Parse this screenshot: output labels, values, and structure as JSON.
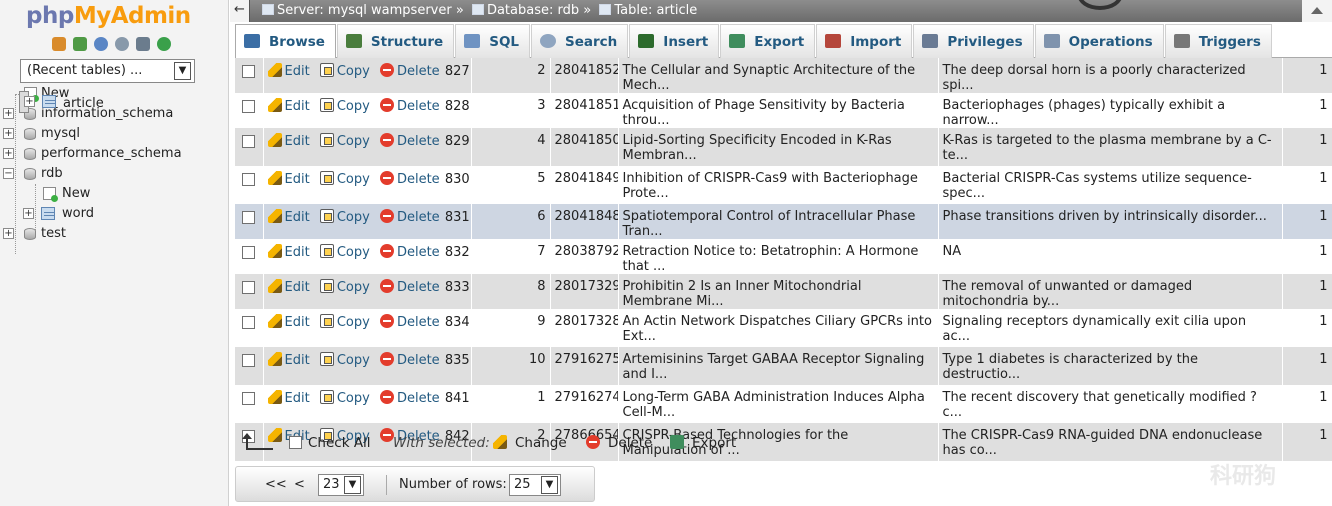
{
  "nav": {
    "logo_part1": "php",
    "logo_part2": "MyAdmin",
    "recent_tables": "(Recent tables) ...",
    "tree": [
      {
        "label": "New"
      },
      {
        "label": "information_schema"
      },
      {
        "label": "mysql"
      },
      {
        "label": "performance_schema"
      },
      {
        "label": "rdb"
      },
      {
        "label": "New"
      },
      {
        "label": "article"
      },
      {
        "label": "word"
      },
      {
        "label": "test"
      }
    ]
  },
  "topbar": {
    "back": "←",
    "server": "Server: mysql wampserver »",
    "database": "Database: rdb »",
    "table": "Table: article"
  },
  "tabs": [
    {
      "label": "Browse",
      "icon": "browse-icon",
      "color": "#3b6ea5"
    },
    {
      "label": "Structure",
      "icon": "structure-icon",
      "color": "#4a7d3d"
    },
    {
      "label": "SQL",
      "icon": "sql-icon",
      "color": "#6f93c2"
    },
    {
      "label": "Search",
      "icon": "search-icon",
      "color": "#8fa5c0"
    },
    {
      "label": "Insert",
      "icon": "insert-icon",
      "color": "#2d6b2d"
    },
    {
      "label": "Export",
      "icon": "export-icon",
      "color": "#3f8d5d"
    },
    {
      "label": "Import",
      "icon": "import-icon",
      "color": "#b5463b"
    },
    {
      "label": "Privileges",
      "icon": "privileges-icon",
      "color": "#6a7b94"
    },
    {
      "label": "Operations",
      "icon": "wrench-icon",
      "color": "#7f93ad"
    },
    {
      "label": "Triggers",
      "icon": "triggers-icon",
      "color": "#777777"
    }
  ],
  "row_actions": {
    "edit": "Edit",
    "copy": "Copy",
    "delete": "Delete"
  },
  "rows": [
    {
      "id": "827",
      "n": "2",
      "pmid": "28041852",
      "title": "The Cellular and Synaptic Architecture of the Mech...",
      "abstract": "The deep dorsal horn is a poorly characterized spi...",
      "flag": "1"
    },
    {
      "id": "828",
      "n": "3",
      "pmid": "28041851",
      "title": "Acquisition of Phage Sensitivity by Bacteria throu...",
      "abstract": "Bacteriophages (phages) typically exhibit a narrow...",
      "flag": "1"
    },
    {
      "id": "829",
      "n": "4",
      "pmid": "28041850",
      "title": "Lipid-Sorting Specificity Encoded in K-Ras Membran...",
      "abstract": "K-Ras is targeted to the plasma membrane by a C-te...",
      "flag": "1"
    },
    {
      "id": "830",
      "n": "5",
      "pmid": "28041849",
      "title": "Inhibition of CRISPR-Cas9 with Bacteriophage Prote...",
      "abstract": "Bacterial CRISPR-Cas systems utilize sequence-spec...",
      "flag": "1"
    },
    {
      "id": "831",
      "n": "6",
      "pmid": "28041848",
      "title": "Spatiotemporal Control of Intracellular Phase Tran...",
      "abstract": "Phase transitions driven by intrinsically disorder...",
      "flag": "1"
    },
    {
      "id": "832",
      "n": "7",
      "pmid": "28038792",
      "title": "Retraction Notice to: Betatrophin: A Hormone that ...",
      "abstract": "NA",
      "flag": "1"
    },
    {
      "id": "833",
      "n": "8",
      "pmid": "28017329",
      "title": "Prohibitin 2 Is an Inner Mitochondrial Membrane Mi...",
      "abstract": "The removal of unwanted or damaged mitochondria by...",
      "flag": "1"
    },
    {
      "id": "834",
      "n": "9",
      "pmid": "28017328",
      "title": "An Actin Network Dispatches Ciliary GPCRs into Ext...",
      "abstract": "Signaling receptors dynamically exit cilia upon ac...",
      "flag": "1"
    },
    {
      "id": "835",
      "n": "10",
      "pmid": "27916275",
      "title": "Artemisinins Target GABAA Receptor Signaling and I...",
      "abstract": "Type 1 diabetes is characterized by the destructio...",
      "flag": "1"
    },
    {
      "id": "841",
      "n": "1",
      "pmid": "27916274",
      "title": "Long-Term GABA Administration Induces Alpha Cell-M...",
      "abstract": "The recent discovery that genetically modified ? c...",
      "flag": "1"
    },
    {
      "id": "842",
      "n": "2",
      "pmid": "27866654",
      "title": "CRISPR-Based Technologies for the Manipulation of ...",
      "abstract": "The CRISPR-Cas9 RNA-guided DNA endonuclease has co...",
      "flag": "1"
    }
  ],
  "with_selected": {
    "check_all": "Check All",
    "label": "With selected:",
    "change": "Change",
    "delete": "Delete",
    "export": "Export"
  },
  "pager": {
    "first": "<<",
    "prev": "<",
    "page": "23",
    "rows_label": "Number of rows:",
    "rows": "25"
  },
  "watermark": "科研狗"
}
